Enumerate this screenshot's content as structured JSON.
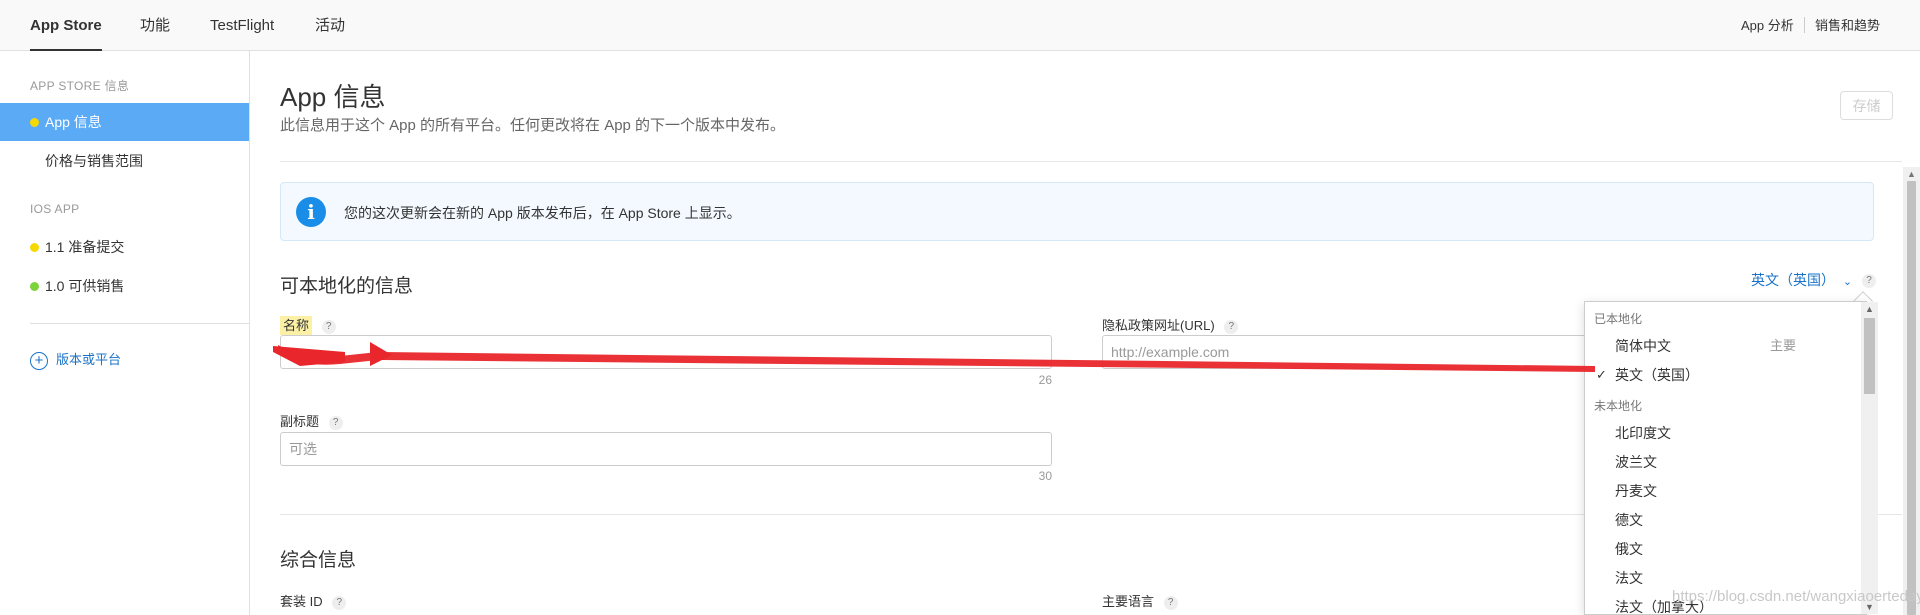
{
  "topnav": {
    "tabs": [
      {
        "label": "App Store"
      },
      {
        "label": "功能"
      },
      {
        "label": "TestFlight"
      },
      {
        "label": "活动"
      }
    ],
    "right_links": [
      {
        "label": "App 分析"
      },
      {
        "label": "销售和趋势"
      }
    ]
  },
  "sidebar": {
    "section_store": "APP STORE 信息",
    "item_app_info": "App 信息",
    "item_pricing": "价格与销售范围",
    "section_ios": "IOS APP",
    "item_v11": "1.1 准备提交",
    "item_v10": "1.0 可供销售",
    "add_version": "版本或平台",
    "colors": {
      "active_bg": "#5aaaf5",
      "dot_yellow": "#f5d800",
      "dot_green": "#7cd33c"
    }
  },
  "main": {
    "title": "App 信息",
    "subtitle": "此信息用于这个 App 的所有平台。任何更改将在 App 的下一个版本中发布。",
    "save_label": "存储",
    "banner": "您的这次更新会在新的 App 版本发布后，在 App Store 上显示。",
    "localizable_title": "可本地化的信息",
    "language_selected": "英文（英国）",
    "name_label": "名称",
    "name_counter": "26",
    "privacy_label": "隐私政策网址(URL)",
    "privacy_placeholder": "http://example.com",
    "subtitle_label": "副标题",
    "subtitle_placeholder": "可选",
    "subtitle_counter": "30",
    "general_title": "综合信息",
    "bundle_label": "套装 ID",
    "primary_lang_label": "主要语言",
    "qmark": "?"
  },
  "dropdown": {
    "group_localized": "已本地化",
    "group_not_localized": "未本地化",
    "localized": [
      {
        "label": "简体中文",
        "primary": "主要",
        "checked": false
      },
      {
        "label": "英文（英国）",
        "primary": "",
        "checked": true
      }
    ],
    "not_localized": [
      {
        "label": "北印度文"
      },
      {
        "label": "波兰文"
      },
      {
        "label": "丹麦文"
      },
      {
        "label": "德文"
      },
      {
        "label": "俄文"
      },
      {
        "label": "法文"
      },
      {
        "label": "法文（加拿大）"
      }
    ]
  },
  "watermark": "https://blog.csdn.net/wangxiaoertedaye",
  "annotation": {
    "color": "#e8262b"
  }
}
